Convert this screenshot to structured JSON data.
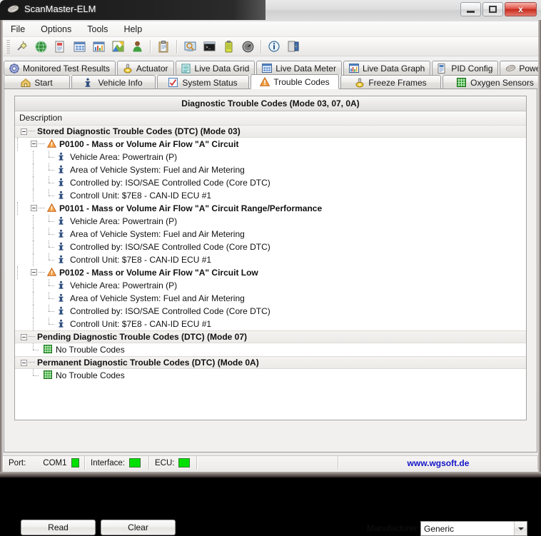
{
  "window": {
    "title": "ScanMaster-ELM",
    "app_icon": "chip-icon",
    "minimize_label": "",
    "maximize_label": "",
    "close_label": "x"
  },
  "menu": {
    "items": [
      {
        "label": "File"
      },
      {
        "label": "Options"
      },
      {
        "label": "Tools"
      },
      {
        "label": "Help"
      }
    ]
  },
  "toolbar": {
    "buttons": [
      {
        "icon": "connect-plug-icon"
      },
      {
        "icon": "globe-icon"
      },
      {
        "icon": "report-page-icon"
      },
      {
        "icon": "grid-table-icon"
      },
      {
        "icon": "bar-chart-icon"
      },
      {
        "icon": "gauge-chart-icon"
      },
      {
        "icon": "user-icon"
      },
      {
        "icon": "separator"
      },
      {
        "icon": "clipboard-icon"
      },
      {
        "icon": "separator"
      },
      {
        "icon": "search-monitor-icon"
      },
      {
        "icon": "terminal-icon"
      },
      {
        "icon": "battery-icon"
      },
      {
        "icon": "speedometer-icon"
      },
      {
        "icon": "separator"
      },
      {
        "icon": "info-icon"
      },
      {
        "icon": "exit-door-icon"
      }
    ]
  },
  "tabs_row1": [
    {
      "label": "Monitored Test Results",
      "icon": "gear-icon",
      "active": false
    },
    {
      "label": "Actuator",
      "icon": "actuator-icon",
      "active": false
    },
    {
      "label": "Live Data Grid",
      "icon": "list-grid-icon",
      "active": false
    },
    {
      "label": "Live Data Meter",
      "icon": "meter-grid-icon",
      "active": false
    },
    {
      "label": "Live Data Graph",
      "icon": "graph-icon",
      "active": false
    },
    {
      "label": "PID Config",
      "icon": "pid-page-icon",
      "active": false
    },
    {
      "label": "Power",
      "icon": "power-chip-icon",
      "active": false
    }
  ],
  "tabs_row2": [
    {
      "label": "Start",
      "icon": "home-icon",
      "active": false
    },
    {
      "label": "Vehicle Info",
      "icon": "info-i-icon",
      "active": false
    },
    {
      "label": "System Status",
      "icon": "checkbox-icon",
      "active": false
    },
    {
      "label": "Trouble Codes",
      "icon": "warning-triangle-icon",
      "active": true
    },
    {
      "label": "Freeze Frames",
      "icon": "actuator-icon",
      "active": false
    },
    {
      "label": "Oxygen Sensors",
      "icon": "green-grid-icon",
      "active": false
    }
  ],
  "panel": {
    "title": "Diagnostic Trouble Codes (Mode 03, 07, 0A)",
    "column_header": "Description"
  },
  "tree": [
    {
      "level": 0,
      "type": "group",
      "icon": "none",
      "label": "Stored Diagnostic Trouble Codes (DTC) (Mode 03)",
      "expanded": true
    },
    {
      "level": 1,
      "type": "dtc",
      "icon": "warning-triangle-icon",
      "label": "P0100 - Mass or Volume Air Flow \"A\" Circuit",
      "expanded": true
    },
    {
      "level": 2,
      "type": "detail",
      "icon": "info-i-icon",
      "label": "Vehicle Area: Powertrain (P)"
    },
    {
      "level": 2,
      "type": "detail",
      "icon": "info-i-icon",
      "label": "Area of Vehicle System: Fuel and Air Metering"
    },
    {
      "level": 2,
      "type": "detail",
      "icon": "info-i-icon",
      "label": "Controlled by: ISO/SAE Controlled Code (Core DTC)"
    },
    {
      "level": 2,
      "type": "detail",
      "icon": "info-i-icon",
      "label": "Controll Unit: $7E8 - CAN-ID ECU #1"
    },
    {
      "level": 1,
      "type": "dtc",
      "icon": "warning-triangle-icon",
      "label": "P0101 - Mass or Volume Air Flow \"A\" Circuit Range/Performance",
      "expanded": true
    },
    {
      "level": 2,
      "type": "detail",
      "icon": "info-i-icon",
      "label": "Vehicle Area: Powertrain (P)"
    },
    {
      "level": 2,
      "type": "detail",
      "icon": "info-i-icon",
      "label": "Area of Vehicle System: Fuel and Air Metering"
    },
    {
      "level": 2,
      "type": "detail",
      "icon": "info-i-icon",
      "label": "Controlled by: ISO/SAE Controlled Code (Core DTC)"
    },
    {
      "level": 2,
      "type": "detail",
      "icon": "info-i-icon",
      "label": "Controll Unit: $7E8 - CAN-ID ECU #1"
    },
    {
      "level": 1,
      "type": "dtc",
      "icon": "warning-triangle-icon",
      "label": "P0102 - Mass or Volume Air Flow \"A\" Circuit Low",
      "expanded": true
    },
    {
      "level": 2,
      "type": "detail",
      "icon": "info-i-icon",
      "label": "Vehicle Area: Powertrain (P)"
    },
    {
      "level": 2,
      "type": "detail",
      "icon": "info-i-icon",
      "label": "Area of Vehicle System: Fuel and Air Metering"
    },
    {
      "level": 2,
      "type": "detail",
      "icon": "info-i-icon",
      "label": "Controlled by: ISO/SAE Controlled Code (Core DTC)"
    },
    {
      "level": 2,
      "type": "detail",
      "icon": "info-i-icon",
      "label": "Controll Unit: $7E8 - CAN-ID ECU #1"
    },
    {
      "level": 0,
      "type": "group",
      "icon": "none",
      "label": "Pending Diagnostic Trouble Codes (DTC) (Mode 07)",
      "expanded": true
    },
    {
      "level": 1,
      "type": "detail",
      "icon": "green-grid-icon",
      "label": "No Trouble Codes"
    },
    {
      "level": 0,
      "type": "group",
      "icon": "none",
      "label": "Permanent Diagnostic Trouble Codes (DTC) (Mode 0A)",
      "expanded": true
    },
    {
      "level": 1,
      "type": "detail",
      "icon": "green-grid-icon",
      "label": "No Trouble Codes"
    }
  ],
  "actions": {
    "read_label": "Read",
    "clear_label": "Clear",
    "manufacturer_label": "Manufacturer",
    "manufacturer_value": "Generic",
    "manufacturer_options": [
      "Generic"
    ]
  },
  "status": {
    "port_label": "Port:",
    "port_value": "COM1",
    "interface_label": "Interface:",
    "ecu_label": "ECU:",
    "url": "www.wgsoft.de",
    "led_color": "#00e000",
    "url_color": "#1414c8"
  }
}
